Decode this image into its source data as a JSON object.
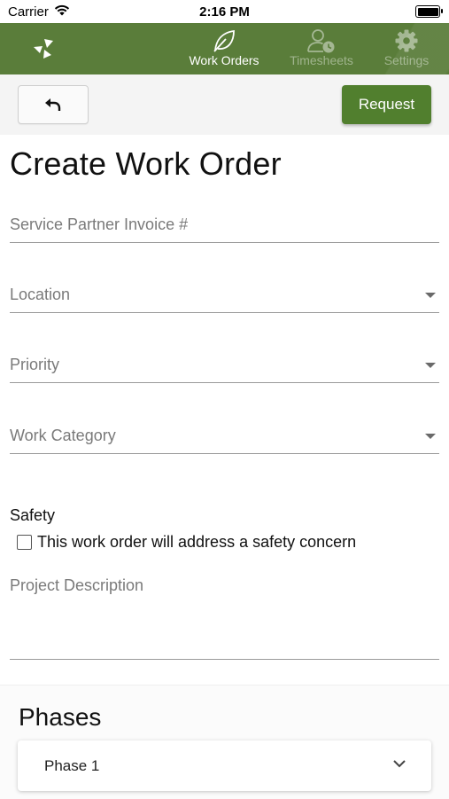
{
  "status_bar": {
    "carrier": "Carrier",
    "time": "2:16 PM"
  },
  "nav": {
    "tabs": [
      {
        "label": "Work Orders",
        "icon": "leaf-icon",
        "active": true
      },
      {
        "label": "Timesheets",
        "icon": "user-clock-icon",
        "active": false
      },
      {
        "label": "Settings",
        "icon": "gear-icon",
        "active": false
      }
    ],
    "colors": {
      "bar": "#5a7d3a",
      "active_text": "#ffffff"
    }
  },
  "toolbar": {
    "back_icon": "undo-arrow-icon",
    "request_label": "Request",
    "request_color": "#517f2e"
  },
  "form": {
    "title": "Create Work Order",
    "invoice_placeholder": "Service Partner Invoice #",
    "location_placeholder": "Location",
    "priority_placeholder": "Priority",
    "work_category_placeholder": "Work Category",
    "safety_label": "Safety",
    "safety_checkbox_label": "This work order will address a safety concern",
    "safety_checked": false,
    "description_placeholder": "Project Description"
  },
  "phases": {
    "title": "Phases",
    "items": [
      {
        "label": "Phase 1"
      }
    ]
  }
}
